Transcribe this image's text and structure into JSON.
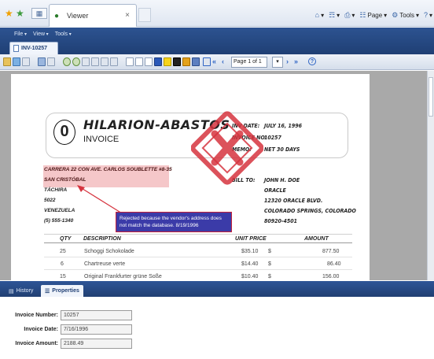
{
  "browser": {
    "tab_title": "Viewer",
    "tab_close": "×",
    "commands": [
      {
        "label": "",
        "glyph": "⌂"
      },
      {
        "label": "",
        "glyph": "☶"
      },
      {
        "label": "",
        "glyph": "⎙"
      },
      {
        "label": "Page",
        "glyph": "☷"
      },
      {
        "label": "Tools",
        "glyph": "⚙"
      },
      {
        "label": "",
        "glyph": "?"
      }
    ]
  },
  "app": {
    "menu": [
      "File",
      "View",
      "Tools"
    ],
    "doc_tab": "INV-10257"
  },
  "toolbar": {
    "page_display": "Page 1 of 1",
    "page_dropdown": "▾"
  },
  "invoice": {
    "company": "HILARION-ABASTOS",
    "doc_type": "INVOICE",
    "logo_letter": "0",
    "meta": {
      "date_label": "INV DATE:",
      "date_value": "JULY 16, 1996",
      "no_label": "INVOICE NO:",
      "no_value": "10257",
      "memo_label": "MEMO:",
      "memo_value": "NET 30 DAYS",
      "bill_label": "BILL TO:"
    },
    "vendor_address": [
      "CARRERA 22 CON AVE. CARLOS SOUBLETTE #8-35",
      "SAN CRISTÓBAL",
      "TÁCHIRA",
      "5022",
      "VENEZUELA",
      "(5) 555-1340"
    ],
    "bill_to": [
      "JOHN H. DOE",
      "ORACLE",
      "12320 ORACLE BLVD.",
      "COLORADO SPRINGS, COLORADO",
      "80920-4501"
    ],
    "rejection_note": "Rejected because the vendor's address does not match the database. 8/19/1996",
    "table": {
      "headers": [
        "QTY",
        "DESCRIPTION",
        "UNIT PRICE",
        "AMOUNT"
      ],
      "rows": [
        {
          "qty": "25",
          "desc": "Schoggi Schokolade",
          "price": "$35.10",
          "cur": "$",
          "amount": "877.50"
        },
        {
          "qty": "6",
          "desc": "Chartreuse verte",
          "price": "$14.40",
          "cur": "$",
          "amount": "86.40"
        },
        {
          "qty": "15",
          "desc": "Original Frankfurter grüne Soße",
          "price": "$10.40",
          "cur": "$",
          "amount": "156.00"
        }
      ]
    }
  },
  "panels": {
    "history_tab": "History",
    "properties_tab": "Properties"
  },
  "properties": {
    "invoice_number_label": "Invoice Number:",
    "invoice_number": "10257",
    "invoice_date_label": "Invoice Date:",
    "invoice_date": "7/16/1996",
    "invoice_amount_label": "Invoice Amount:",
    "invoice_amount": "2188.49"
  },
  "colors": {
    "header_blue": "#2d5391",
    "highlight_pink": "#f5c7c9",
    "note_blue": "#3b3ba8",
    "stamp_red": "#d6343f"
  }
}
